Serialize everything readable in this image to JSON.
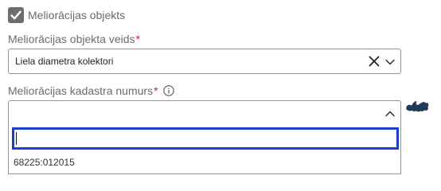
{
  "checkbox": {
    "label": "Meliorācijas objekts",
    "checked": true
  },
  "object_type": {
    "label": "Meliorācijas objekta veids",
    "required_mark": "*",
    "value": "Liela diametra kolektori"
  },
  "cadastre": {
    "label": "Meliorācijas kadastra numurs",
    "required_mark": "*",
    "search_value": "",
    "options": [
      "68225:012015"
    ]
  },
  "icons": {
    "checkbox": "checkmark-icon",
    "clear": "close-icon",
    "dropdown": "chevron-down-icon",
    "dropdown_open": "chevron-up-icon",
    "info": "info-icon",
    "map": "latvia-map-icon"
  },
  "colors": {
    "focus_border": "#1c3fc8",
    "required": "#c4262e",
    "checkbox_fill": "#6e6e6e",
    "map_icon": "#1f3a5a"
  }
}
